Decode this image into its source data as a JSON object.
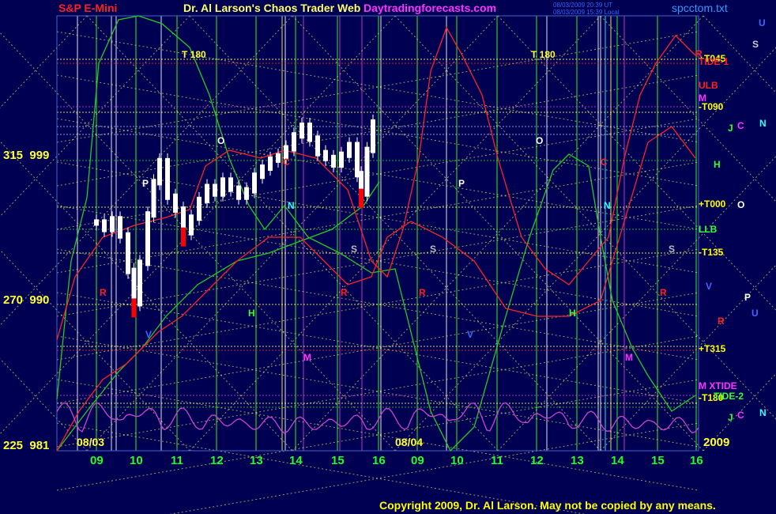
{
  "header": {
    "left_title": "S&P E-Mini",
    "center_title": "Dr. Al Larson's Chaos Trader Web",
    "website": "Daytradingforecasts.com",
    "timestamp_1": "08/03/2009 20:39 UT",
    "timestamp_2": "08/03/2009 15:39 Local",
    "file": "spcctom.txt"
  },
  "y_axis_labels": [
    {
      "angle": "315",
      "price": "999"
    },
    {
      "angle": "270",
      "price": "990"
    },
    {
      "angle": "225",
      "price": "981"
    }
  ],
  "copyright": "Copyright 2009, Dr. Al Larson. May not be copied by any means.",
  "colors": {
    "background": "#000052",
    "grid_yellow": "#ffff66",
    "grid_green": "#22cc22",
    "red_line": "#ff2222",
    "green_line": "#22cc22",
    "magenta_line": "#cc44cc",
    "candle_white": "#ffffff",
    "candle_red": "#ff0000"
  },
  "chart_data": {
    "type": "candlestick",
    "y_scale_angles": [
      "315",
      "270",
      "225"
    ],
    "y_scale_prices": [
      "999",
      "990",
      "981"
    ],
    "ylim": [
      981,
      1004
    ],
    "date_labels": [
      "08/03",
      "08/04",
      "2009"
    ],
    "hour_ticks": [
      "09",
      "10",
      "11",
      "12",
      "13",
      "14",
      "15",
      "16",
      "09",
      "10",
      "11",
      "12",
      "13",
      "14",
      "15",
      "16"
    ],
    "price_series": [
      {
        "hour": 9.0,
        "price": 995.0
      },
      {
        "hour": 9.2,
        "price": 994.6
      },
      {
        "hour": 9.4,
        "price": 995.2
      },
      {
        "hour": 9.6,
        "price": 994.2
      },
      {
        "hour": 9.8,
        "price": 992.0
      },
      {
        "hour": 9.95,
        "price": 990.0
      },
      {
        "hour": 10.1,
        "price": 992.5
      },
      {
        "hour": 10.3,
        "price": 995.5
      },
      {
        "hour": 10.45,
        "price": 997.5
      },
      {
        "hour": 10.6,
        "price": 998.8
      },
      {
        "hour": 10.8,
        "price": 996.6
      },
      {
        "hour": 11.0,
        "price": 995.8
      },
      {
        "hour": 11.2,
        "price": 994.4
      },
      {
        "hour": 11.4,
        "price": 995.3
      },
      {
        "hour": 11.6,
        "price": 996.4
      },
      {
        "hour": 11.8,
        "price": 997.2
      },
      {
        "hour": 12.0,
        "price": 996.8
      },
      {
        "hour": 12.2,
        "price": 997.6
      },
      {
        "hour": 12.4,
        "price": 997.1
      },
      {
        "hour": 12.6,
        "price": 996.6
      },
      {
        "hour": 12.8,
        "price": 997.0
      },
      {
        "hour": 13.0,
        "price": 997.9
      },
      {
        "hour": 13.2,
        "price": 998.4
      },
      {
        "hour": 13.4,
        "price": 998.9
      },
      {
        "hour": 13.6,
        "price": 999.1
      },
      {
        "hour": 13.8,
        "price": 999.6
      },
      {
        "hour": 14.0,
        "price": 1000.4
      },
      {
        "hour": 14.2,
        "price": 1001.0
      },
      {
        "hour": 14.4,
        "price": 1000.2
      },
      {
        "hour": 14.6,
        "price": 999.3
      },
      {
        "hour": 14.8,
        "price": 999.0
      },
      {
        "hour": 15.0,
        "price": 998.6
      },
      {
        "hour": 15.2,
        "price": 999.2
      },
      {
        "hour": 15.4,
        "price": 999.8
      },
      {
        "hour": 15.6,
        "price": 998.0
      },
      {
        "hour": 15.7,
        "price": 996.8
      },
      {
        "hour": 15.85,
        "price": 999.5
      },
      {
        "hour": 16.0,
        "price": 1001.2
      }
    ],
    "red_dips": [
      {
        "hour": 9.95,
        "price": 990.0
      },
      {
        "hour": 11.2,
        "price": 994.4
      },
      {
        "hour": 15.7,
        "price": 996.8
      }
    ],
    "right_labels": [
      {
        "text": "+T045",
        "color": "#ffff00"
      },
      {
        "text": "TIDE-1",
        "color": "#ff2020"
      },
      {
        "text": "ULB",
        "color": "#ff2020"
      },
      {
        "text": "M",
        "color": "#ff33ff"
      },
      {
        "text": "-T090",
        "color": "#ffff00"
      },
      {
        "text": "H",
        "color": "#33ff33"
      },
      {
        "text": "+T000",
        "color": "#ffff00"
      },
      {
        "text": "LLB",
        "color": "#33ff33"
      },
      {
        "text": "-T135",
        "color": "#ffff00"
      },
      {
        "text": "+T315",
        "color": "#ffff00"
      },
      {
        "text": "M  XTIDE",
        "color": "#ff33ff"
      },
      {
        "text": "-T180",
        "color": "#ffff00"
      },
      {
        "text": "TIDE-2",
        "color": "#33ff33"
      }
    ],
    "far_right_letters": [
      {
        "text": "U",
        "color": "#4466ff"
      },
      {
        "text": "S",
        "color": "#cccccc"
      },
      {
        "text": "R",
        "color": "#ff2020"
      },
      {
        "text": "J",
        "color": "#33ff33"
      },
      {
        "text": "C",
        "color": "#ff33ff"
      },
      {
        "text": "N",
        "color": "#33ffff"
      },
      {
        "text": "O",
        "color": "#ffffff"
      },
      {
        "text": "V",
        "color": "#4466ff"
      },
      {
        "text": "P",
        "color": "#ffffff"
      },
      {
        "text": "U",
        "color": "#4466ff"
      },
      {
        "text": "R",
        "color": "#ff2020"
      },
      {
        "text": "J",
        "color": "#33ff33"
      },
      {
        "text": "C",
        "color": "#ff33ff"
      },
      {
        "text": "N",
        "color": "#33ffff"
      }
    ],
    "planet_markers": [
      {
        "text": "T  180",
        "color": "#ffff33"
      },
      {
        "text": "T  180",
        "color": "#ffff33"
      },
      {
        "text": "O",
        "color": "#ffffff"
      },
      {
        "text": "O",
        "color": "#ffffff"
      },
      {
        "text": "P",
        "color": "#ffffff"
      },
      {
        "text": "P",
        "color": "#ffffff"
      },
      {
        "text": "N",
        "color": "#33ffff"
      },
      {
        "text": "N",
        "color": "#33ffff"
      },
      {
        "text": "S",
        "color": "#bbbbbb"
      },
      {
        "text": "S",
        "color": "#bbbbbb"
      },
      {
        "text": "S",
        "color": "#bbbbbb"
      },
      {
        "text": "R",
        "color": "#ff2020"
      },
      {
        "text": "R",
        "color": "#ff2020"
      },
      {
        "text": "R",
        "color": "#ff2020"
      },
      {
        "text": "R",
        "color": "#ff2020"
      },
      {
        "text": "H",
        "color": "#33ff33"
      },
      {
        "text": "H",
        "color": "#33ff33"
      },
      {
        "text": "M",
        "color": "#ff33ff"
      },
      {
        "text": "M",
        "color": "#ff33ff"
      },
      {
        "text": "V",
        "color": "#4466ff"
      },
      {
        "text": "V",
        "color": "#4466ff"
      },
      {
        "text": "C",
        "color": "#ff2020"
      },
      {
        "text": "C",
        "color": "#ff2020"
      }
    ]
  }
}
